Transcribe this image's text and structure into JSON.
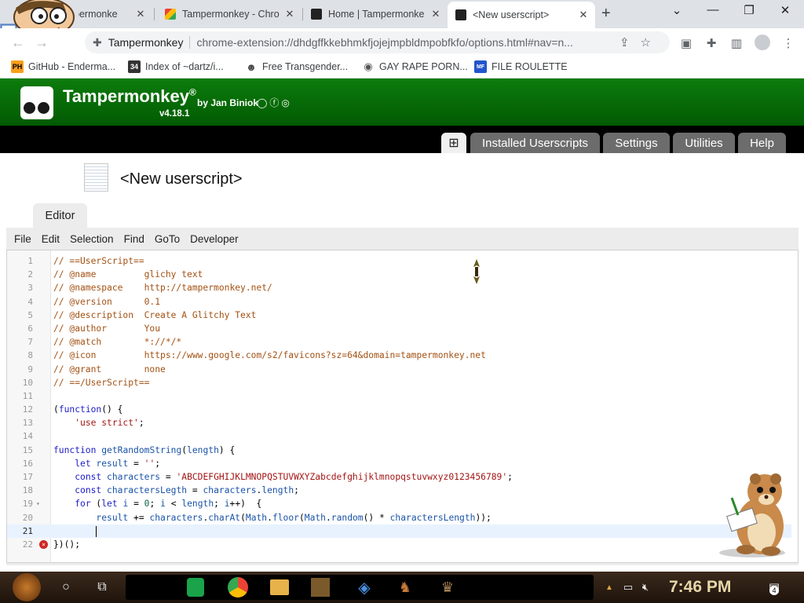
{
  "browser": {
    "tabs": [
      {
        "title": "Tampermonkey",
        "favicon": "tampermonkey-icon",
        "active": false
      },
      {
        "title": "Tampermonkey - Chrome Web Store",
        "favicon": "chrome-web-store-icon",
        "active": false
      },
      {
        "title": "Home | Tampermonkey",
        "favicon": "tampermonkey-icon",
        "active": false
      },
      {
        "title": "<New userscript>",
        "favicon": "tampermonkey-icon",
        "active": true
      }
    ],
    "tab_visible_text": [
      "permonke",
      "Tampermonkey - Chro",
      "Home | Tampermonke",
      "<New userscript>"
    ],
    "new_tab": "+",
    "window_controls": {
      "minimize": "⌄",
      "restore": "—",
      "maximize": "❐",
      "close": "✕"
    },
    "omnibox": {
      "extension_name": "Tampermonkey",
      "url": "chrome-extension://dhdgffkkebhmkfjojejmpbldmpobfkfo/options.html#nav=n..."
    },
    "bookmarks": [
      {
        "label": "GitHub - Enderma...",
        "icon": "PH",
        "color": "#f9a01b"
      },
      {
        "label": "Index of ~dartz/i...",
        "icon": "34",
        "color": "#333333"
      },
      {
        "label": "Free Transgender...",
        "icon": "mask",
        "color": "#444444"
      },
      {
        "label": "GAY RAPE PORN...",
        "icon": "globe",
        "color": "#555555"
      },
      {
        "label": "FILE ROULETTE",
        "icon": "MF",
        "color": "#2255cc"
      }
    ]
  },
  "tampermonkey": {
    "name": "Tampermonkey",
    "registered": "®",
    "by": "by Jan Biniok",
    "version": "v4.18.1",
    "social": "◯ⓕ◎",
    "brand_green": "#036d03",
    "nav_tabs": [
      {
        "label": "⊞",
        "name": "new-script-tab"
      },
      {
        "label": "Installed Userscripts",
        "name": "installed-userscripts-tab"
      },
      {
        "label": "Settings",
        "name": "settings-tab"
      },
      {
        "label": "Utilities",
        "name": "utilities-tab"
      },
      {
        "label": "Help",
        "name": "help-tab"
      }
    ],
    "script_title": "<New userscript>",
    "editor_tab": "Editor"
  },
  "editor": {
    "menu": [
      "File",
      "Edit",
      "Selection",
      "Find",
      "GoTo",
      "Developer"
    ],
    "active_line": 21,
    "error_line": 22,
    "fold_line": 19,
    "lines": [
      "// ==UserScript==",
      "// @name         glichy text",
      "// @namespace    http://tampermonkey.net/",
      "// @version      0.1",
      "// @description  Create A Glitchy Text",
      "// @author       You",
      "// @match        *://*/*",
      "// @icon         https://www.google.com/s2/favicons?sz=64&domain=tampermonkey.net",
      "// @grant        none",
      "// ==/UserScript==",
      "",
      "(function() {",
      "    'use strict';",
      "",
      "function getRandomString(length) {",
      "    let result = '';",
      "    const characters = 'ABCDEFGHIJKLMNOPQSTUVWXYZabcdefghijklmnopqstuvwxyz0123456789';",
      "    const charactersLegth = characters.length;",
      "    for (let i = 0; i < length; i++)  {",
      "        result += characters.charAt(Math.floor(Math.random() * charactersLength));",
      "        ",
      "})();"
    ]
  },
  "taskbar": {
    "clock": "7:46 PM",
    "notification_count": "4"
  }
}
